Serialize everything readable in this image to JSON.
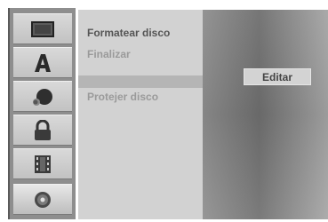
{
  "sidebar": {
    "items": [
      {
        "icon": "disc-menu-icon"
      },
      {
        "icon": "title-letter-icon"
      },
      {
        "icon": "audio-icon"
      },
      {
        "icon": "lock-icon"
      },
      {
        "icon": "film-icon"
      },
      {
        "icon": "disc-icon",
        "active": true
      }
    ]
  },
  "menu": {
    "formatear": "Formatear disco",
    "finalizar": "Finalizar",
    "proteger": "Protejer disco"
  },
  "submenu": {
    "editar": "Editar"
  },
  "colors": {
    "menu_bg": "#d2d2d2",
    "active_text": "#555555",
    "inactive_text": "#9a9a9a"
  }
}
